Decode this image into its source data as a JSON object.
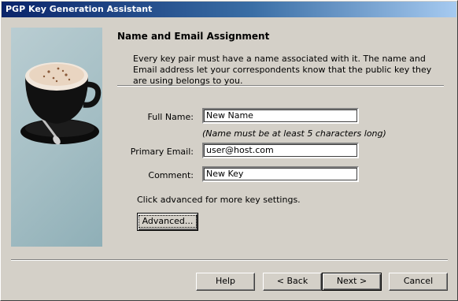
{
  "window": {
    "title": "PGP Key Generation Assistant"
  },
  "page": {
    "heading": "Name and Email Assignment",
    "intro": "Every key pair must have a name associated with it. The name and Email address let your correspondents know that the public key they are using belongs to you."
  },
  "form": {
    "full_name_label": "Full Name:",
    "full_name_value": "New Name",
    "name_note": "(Name must be at least 5 characters long)",
    "email_label": "Primary Email:",
    "email_value": "user@host.com",
    "comment_label": "Comment:",
    "comment_value": "New Key"
  },
  "advanced": {
    "text": "Click advanced for more key settings.",
    "button_label": "Advanced..."
  },
  "buttons": {
    "help": "Help",
    "back": "< Back",
    "next": "Next >",
    "cancel": "Cancel"
  },
  "icons": {
    "side_image": "coffee-cup-illustration"
  },
  "colors": {
    "titlebar_start": "#0a246a",
    "titlebar_end": "#a6caf0",
    "dialog_bg": "#d4d0c8",
    "side_panel": "#a4bec4"
  }
}
